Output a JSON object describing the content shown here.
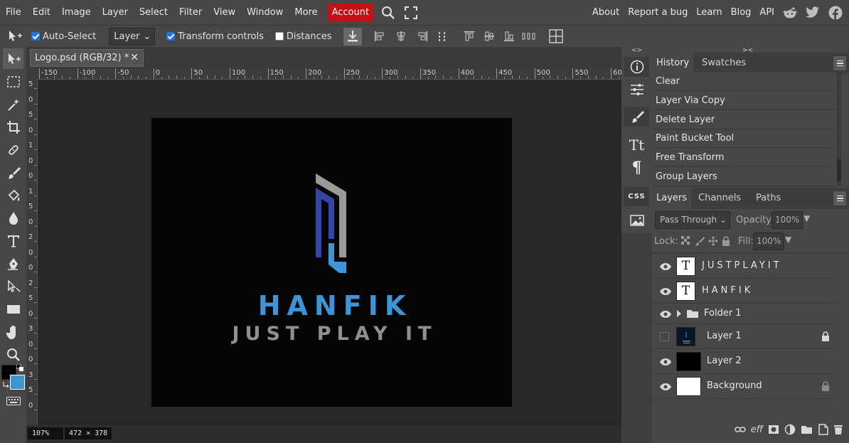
{
  "menubar": {
    "items": [
      "File",
      "Edit",
      "Image",
      "Layer",
      "Select",
      "Filter",
      "View",
      "Window",
      "More"
    ],
    "account": "Account",
    "right_links": [
      "About",
      "Report a bug",
      "Learn",
      "Blog",
      "API"
    ],
    "social_icons": [
      "reddit-icon",
      "twitter-icon",
      "facebook-icon"
    ]
  },
  "options": {
    "auto_select": "Auto-Select",
    "auto_select_mode": "Layer",
    "transform_controls": "Transform controls",
    "distances": "Distances"
  },
  "document": {
    "tab_title": "Logo.psd (RGB/32) *",
    "tab_close": "✕",
    "zoom": "107%",
    "size": "472 × 378",
    "ruler_h": [
      "-150",
      "-100",
      "-50",
      "0",
      "50",
      "100",
      "150",
      "200",
      "250",
      "300",
      "350",
      "400",
      "450",
      "500",
      "550",
      "60"
    ],
    "ruler_v": [
      "5",
      "0",
      "5",
      "0",
      "1",
      "0",
      "0",
      "1",
      "5",
      "0",
      "2",
      "0",
      "0",
      "2",
      "5",
      "0",
      "3",
      "0",
      "0",
      "3",
      "5",
      "0"
    ]
  },
  "canvas": {
    "logo_title": "HANFIK",
    "logo_tagline": "JUST PLAY IT",
    "colors": {
      "background": "#050505",
      "title": "#3d95d8",
      "tagline": "#8f8f8f",
      "mark_blue": "#3346a8",
      "mark_grey": "#9a9a9a"
    }
  },
  "history": {
    "tabs": [
      "History",
      "Swatches"
    ],
    "items": [
      "Clear",
      "Layer Via Copy",
      "Delete Layer",
      "Paint Bucket Tool",
      "Free Transform",
      "Group Layers"
    ]
  },
  "layers": {
    "tabs": [
      "Layers",
      "Channels",
      "Paths"
    ],
    "blend_mode": "Pass Through",
    "opacity_label": "Opacity:",
    "opacity_value": "100%",
    "lock_label": "Lock:",
    "fill_label": "Fill:",
    "fill_value": "100%",
    "items": [
      {
        "name": "JUSTPLAYIT",
        "type": "text",
        "thumb": "T"
      },
      {
        "name": "HANFIK",
        "type": "text",
        "thumb": "T"
      },
      {
        "name": "Folder 1",
        "type": "folder"
      },
      {
        "name": "Layer 1",
        "type": "image",
        "locked": true,
        "visible": false
      },
      {
        "name": "Layer 2",
        "type": "image"
      },
      {
        "name": "Background",
        "type": "image",
        "locked": true
      }
    ],
    "footer_eff": "eff"
  },
  "strip": {
    "css_label": "CSS"
  }
}
